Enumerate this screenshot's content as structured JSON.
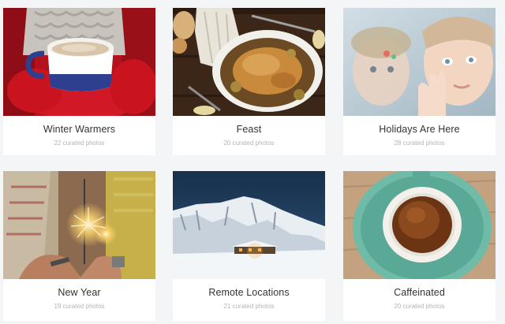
{
  "collections": [
    {
      "title": "Winter Warmers",
      "count": "22 curated photos",
      "image": "mug-in-red-mittens-photo"
    },
    {
      "title": "Feast",
      "count": "20 curated photos",
      "image": "roast-chicken-photo"
    },
    {
      "title": "Holidays Are Here",
      "count": "28 curated photos",
      "image": "children-at-frosted-window-photo"
    },
    {
      "title": "New Year",
      "count": "19 curated photos",
      "image": "sparkler-in-hands-photo"
    },
    {
      "title": "Remote Locations",
      "count": "21 curated photos",
      "image": "snowy-mountain-cabin-photo"
    },
    {
      "title": "Caffeinated",
      "count": "20 curated photos",
      "image": "coffee-cup-photo"
    }
  ]
}
